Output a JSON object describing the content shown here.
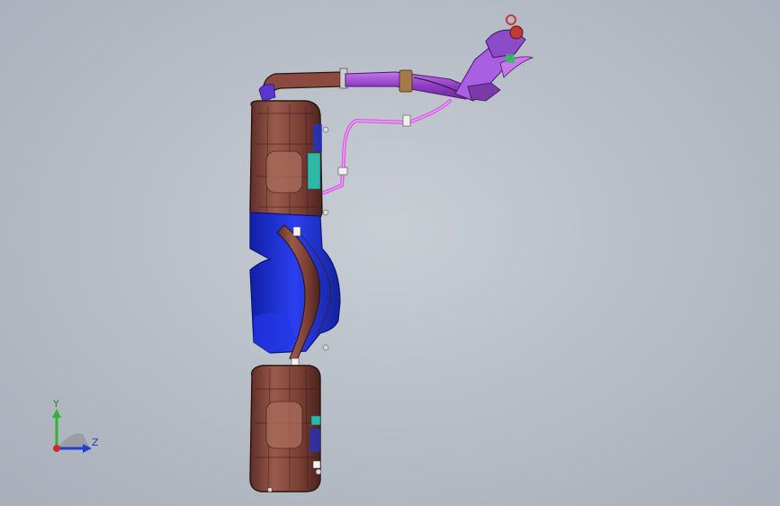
{
  "viewport": {
    "background_top": "#c9ced5",
    "background_bottom": "#a8afba"
  },
  "model": {
    "description_colors": {
      "tank_shell": "#8a4a3f",
      "tank_edge": "#3a1f1a",
      "tank_blue": "#1d2fd1",
      "hose_purple": "#a64fd6",
      "hose_magenta": "#d85ae8",
      "filler_neck": "#b26ae6",
      "cap_red": "#c23a34"
    }
  },
  "triad": {
    "y_label": "Y",
    "z_label": "Z",
    "y_color": "#2fb52f",
    "z_color": "#1f3fd1",
    "x_color": "#d12a2a"
  }
}
